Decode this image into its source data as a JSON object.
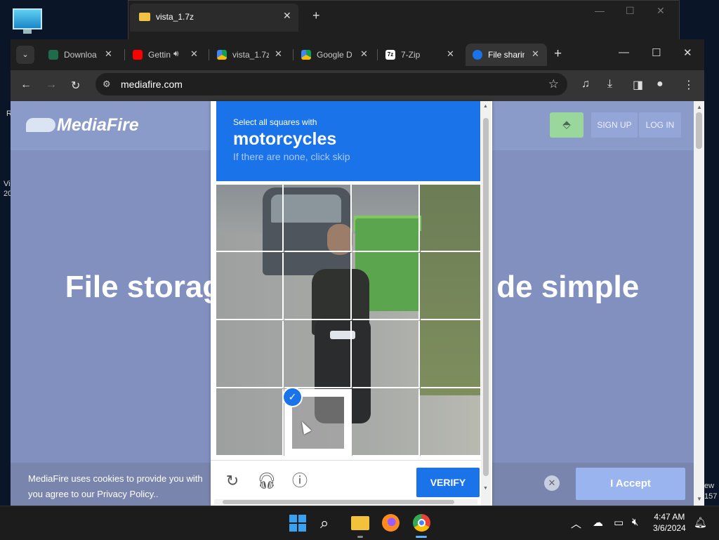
{
  "desktop": {
    "peek_texts": [
      "R",
      "Vi",
      "20",
      "ew",
      "157"
    ]
  },
  "bg_window": {
    "tab_title": "vista_1.7z"
  },
  "browser": {
    "tabs": [
      {
        "label": "Downloa",
        "icon": "kinsta-icon"
      },
      {
        "label": "Gettin",
        "icon": "youtube-icon"
      },
      {
        "label": "vista_1.7z",
        "icon": "google-drive-icon"
      },
      {
        "label": "Google D",
        "icon": "google-drive-icon"
      },
      {
        "label": "7-Zip",
        "icon": "7zip-icon"
      },
      {
        "label": "File sharin",
        "icon": "mediafire-icon"
      }
    ],
    "url": "mediafire.com"
  },
  "mediafire": {
    "logo": "MediaFire",
    "sign_up": "SIGN UP",
    "log_in": "LOG IN",
    "hero_left": "File storag",
    "hero_right": "de simple",
    "cookie_text": "MediaFire uses cookies to provide you with you agree to our Privacy Policy..",
    "accept": "I Accept",
    "colors": {
      "page_bg": "#8190bf",
      "accept": "#9ab4f0",
      "upload": "#9ad79d"
    }
  },
  "captcha": {
    "instruction": "Select all squares with",
    "target": "motorcycles",
    "hint": "If there are none, click skip",
    "verify": "VERIFY",
    "selected_tiles": [
      13
    ],
    "accent": "#1a73e8"
  },
  "taskbar": {
    "time": "4:47 AM",
    "date": "3/6/2024"
  }
}
